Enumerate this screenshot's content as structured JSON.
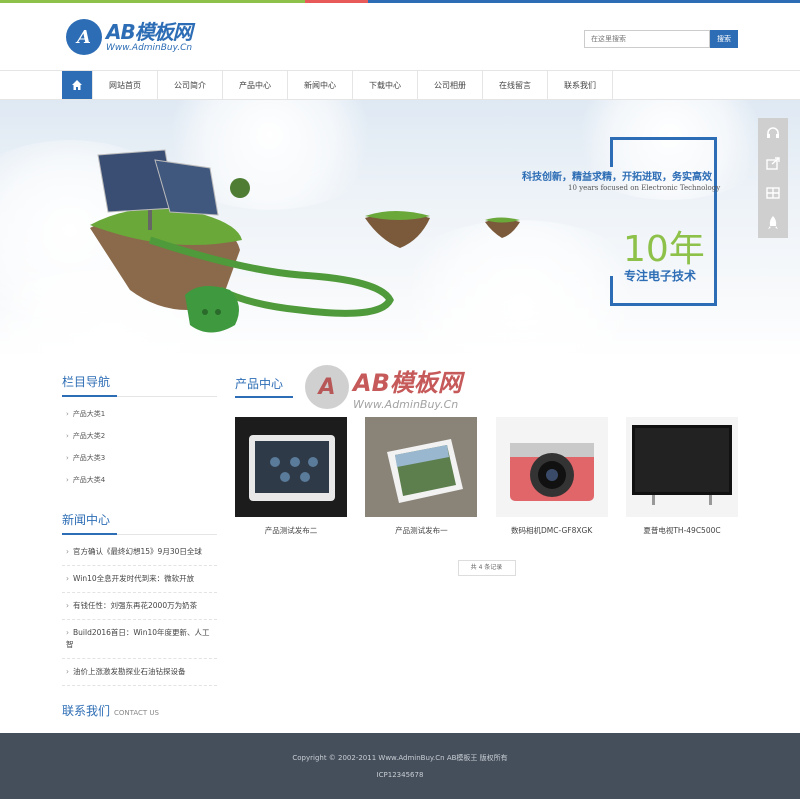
{
  "header": {
    "logo_mark": "A",
    "logo_title": "AB模板网",
    "logo_url": "Www.AdminBuy.Cn",
    "search_placeholder": "在这里搜索",
    "search_button": "搜索"
  },
  "nav": {
    "home_icon": "home-icon",
    "items": [
      "网站首页",
      "公司简介",
      "产品中心",
      "新闻中心",
      "下载中心",
      "公司相册",
      "在线留言",
      "联系我们"
    ]
  },
  "banner": {
    "slogan": "科技创新，精益求精，开拓进取，务实高效",
    "slogan_en": "10 years focused on Electronic Technology",
    "years": "10年",
    "focus": "专注电子技术"
  },
  "sidetools": [
    "headset-icon",
    "share-icon",
    "grid-icon",
    "rocket-icon"
  ],
  "sidebar": {
    "cat_title": "栏目导航",
    "categories": [
      "产品大类1",
      "产品大类2",
      "产品大类3",
      "产品大类4"
    ],
    "news_title": "新闻中心",
    "news": [
      "官方确认《最终幻想15》9月30日全球",
      "Win10全息开发时代到来：微软开放",
      "有钱任性：刘强东再花2000万为奶茶",
      "Build2016首日：Win10年度更新、人工智",
      "油价上涨激发勘探业石油钻探设备"
    ],
    "contact_title": "联系我们",
    "contact_en": "CONTACT US"
  },
  "main": {
    "title": "产品中心",
    "products": [
      {
        "caption": "产品测试发布二"
      },
      {
        "caption": "产品测试发布一"
      },
      {
        "caption": "数码相机DMC-GF8XGK"
      },
      {
        "caption": "夏普电视TH-49C500C"
      }
    ],
    "pager": "共 4 条记录"
  },
  "watermark": {
    "mark": "A",
    "title": "AB模板网",
    "url": "Www.AdminBuy.Cn"
  },
  "footer": {
    "copyright": "Copyright © 2002-2011 Www.AdminBuy.Cn AB模板王 版权所有",
    "icp": "ICP12345678"
  },
  "colors": {
    "accent": "#2d6db5",
    "green": "#8dc14a",
    "red": "#e85a5a",
    "footer_bg": "#454f5c"
  }
}
